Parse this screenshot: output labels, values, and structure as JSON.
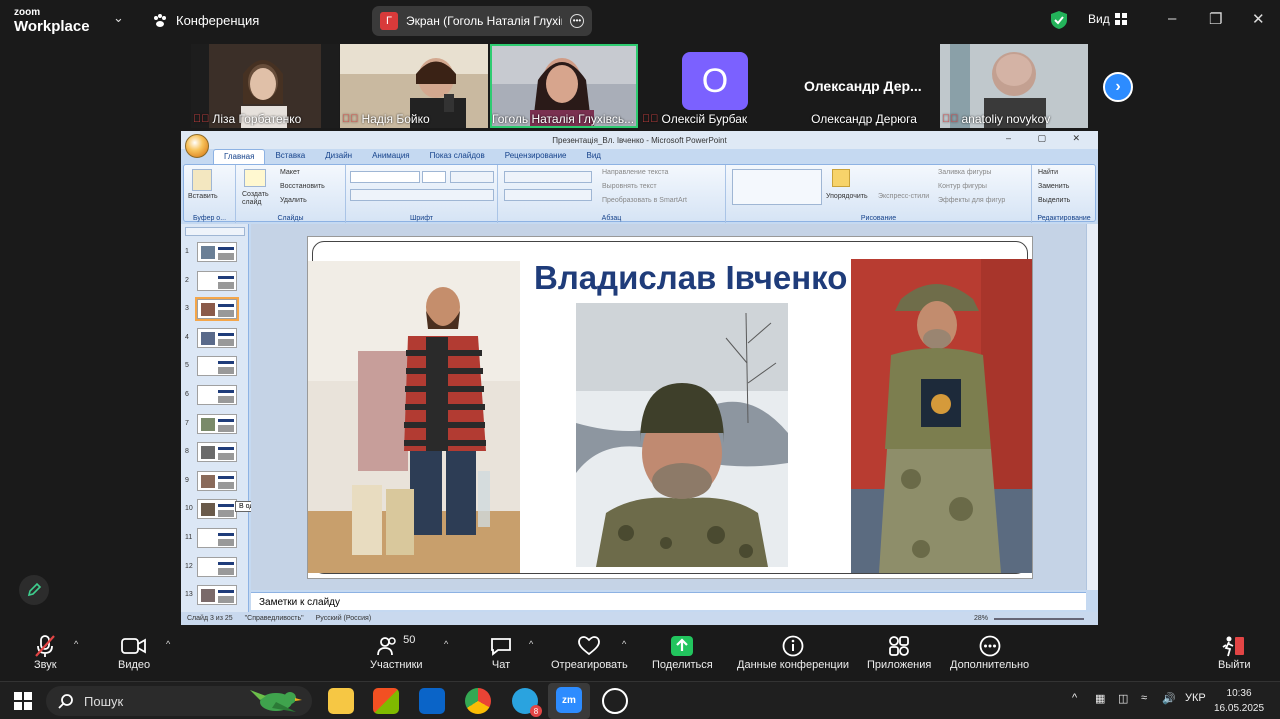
{
  "top_bar": {
    "logo_line1": "zoom",
    "logo_line2": "Workplace",
    "conference_label": "Конференция",
    "screen_share_label": "Экран (Гоголь Наталія Глухівсь",
    "share_badge_letter": "Г",
    "view_label": "Вид"
  },
  "participants": [
    {
      "name": "Ліза Горбатенко",
      "muted": true
    },
    {
      "name": "Надія Бойко",
      "muted": true
    },
    {
      "name": "Гоголь Наталія Глухівсь...",
      "muted": false,
      "active_speaker": true
    },
    {
      "name": "Олексій Бурбак",
      "muted": true,
      "avatar_letter": "О"
    },
    {
      "name": "Олександр Дерюга",
      "muted": false,
      "display_title": "Олександр  Дер..."
    },
    {
      "name": "anatoliy novykov",
      "muted": true
    }
  ],
  "ppt": {
    "window_title": "Презентація_Вл. Івченко - Microsoft PowerPoint",
    "tabs": [
      "Главная",
      "Вставка",
      "Дизайн",
      "Анимация",
      "Показ слайдов",
      "Рецензирование",
      "Вид"
    ],
    "groups": {
      "clipboard": {
        "paste": "Вставить",
        "caption": "Буфер о..."
      },
      "slides": {
        "new_slide": "Создать слайд",
        "layout": "Макет",
        "reset": "Восстановить",
        "delete": "Удалить",
        "caption": "Слайды"
      },
      "font": {
        "caption": "Шрифт"
      },
      "paragraph": {
        "text_direction": "Направление текста",
        "align_text": "Выровнять текст",
        "smartart": "Преобразовать в SmartArt",
        "caption": "Абзац"
      },
      "drawing": {
        "arrange": "Упорядочить",
        "quick_styles": "Экспресс-стили",
        "shape_fill": "Заливка фигуры",
        "shape_outline": "Контур фигуры",
        "shape_effects": "Эффекты для фигур",
        "caption": "Рисование"
      },
      "editing": {
        "find": "Найти",
        "replace": "Заменить",
        "select": "Выделить",
        "caption": "Редактирование"
      }
    },
    "slide_numbers": [
      "1",
      "2",
      "3",
      "4",
      "5",
      "6",
      "7",
      "8",
      "9",
      "10",
      "11",
      "12",
      "13"
    ],
    "current_slide_index": 2,
    "tooltip": "В одному із інтерв'ю Влад...",
    "slide_title": "Владислав Івченко",
    "notes_placeholder": "Заметки к слайду",
    "status": {
      "slide_of": "Слайд 3 из 25",
      "theme": "\"Справедливость\"",
      "language": "Русский (Россия)",
      "zoom": "28%"
    }
  },
  "toolbar": {
    "audio": "Звук",
    "video": "Видео",
    "participants": "Участники",
    "participants_count": "50",
    "chat": "Чат",
    "react": "Отреагировать",
    "share": "Поделиться",
    "meeting_info": "Данные конференции",
    "apps": "Приложения",
    "more": "Дополнительно",
    "leave": "Выйти"
  },
  "taskbar": {
    "search_placeholder": "Пошук",
    "telegram_badge": "8",
    "language": "УКР",
    "time": "10:36",
    "date": "16.05.2025"
  }
}
